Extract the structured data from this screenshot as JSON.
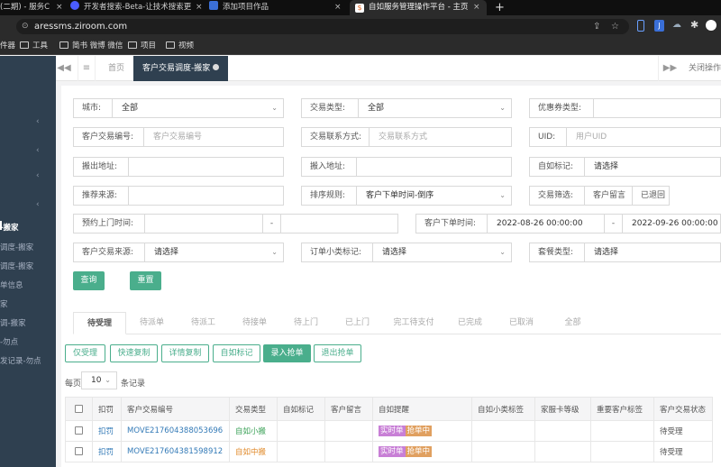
{
  "browser": {
    "tabs": [
      {
        "label": "(二期) - 服务C"
      },
      {
        "label": "开发者搜索-Beta-让技术搜索更"
      },
      {
        "label": "添加项目作品"
      },
      {
        "label": "自如服务管理操作平台 - 主页"
      }
    ],
    "new_tab": "+",
    "url": "aressms.ziroom.com",
    "bookmarks": [
      "件器",
      "工具",
      "简书 微博 微信",
      "项目",
      "视频"
    ]
  },
  "sidebar": {
    "items": [
      {
        "label": "-搬家",
        "bold": true
      },
      {
        "label": "调度-搬家"
      },
      {
        "label": "调度-搬家"
      },
      {
        "label": "单信息"
      },
      {
        "label": "家"
      },
      {
        "label": "调-搬家"
      },
      {
        "label": "-勿点"
      },
      {
        "label": "发记录-勿点"
      }
    ],
    "chevrons": [
      "‹",
      "‹",
      "‹",
      "‹"
    ]
  },
  "topnav": {
    "back_icon": "◀◀",
    "menu_icon": "≡",
    "home_tab": "首页",
    "active_tab": "客户交易调度-搬家",
    "forward_icon": "▶▶",
    "close_ops": "关闭操作"
  },
  "filters": {
    "city_label": "城市:",
    "city_value": "全部",
    "trade_type_label": "交易类型:",
    "trade_type_value": "全部",
    "coupon_label": "优惠券类型:",
    "trade_no_label": "客户交易编号:",
    "trade_no_ph": "客户交易编号",
    "contact_label": "交易联系方式:",
    "contact_ph": "交易联系方式",
    "uid_label": "UID:",
    "uid_ph": "用户UID",
    "move_out_label": "搬出地址:",
    "move_in_label": "搬入地址:",
    "ziru_mark_label": "自如标记:",
    "ziru_mark_ph": "请选择",
    "referral_label": "推荐来源:",
    "sort_label": "排序规则:",
    "sort_value": "客户下单时间-倒序",
    "trade_filter_label": "交易筛选:",
    "trade_filter_opt1": "客户留言",
    "trade_filter_opt2": "已退回",
    "appoint_label": "预约上门时间:",
    "dash1": "-",
    "order_time_label": "客户下单时间:",
    "order_time_start": "2022-08-26 00:00:00",
    "dash2": "-",
    "order_time_end": "2022-09-26 00:00:00",
    "source_label": "客户交易来源:",
    "source_ph": "请选择",
    "sub_mark_label": "订单小类标记:",
    "sub_mark_ph": "请选择",
    "package_label": "套餐类型:",
    "package_ph": "请选择",
    "query_btn": "查询",
    "reset_btn": "重置"
  },
  "status_tabs": [
    "待受理",
    "待派单",
    "待派工",
    "待接单",
    "待上门",
    "已上门",
    "完工待支付",
    "已完成",
    "已取消",
    "全部"
  ],
  "actions": [
    "仅受理",
    "快速复制",
    "详情复制",
    "自如标记",
    "录入抢单",
    "退出抢单"
  ],
  "paging": {
    "prefix": "每页",
    "size": "10",
    "suffix": "条记录"
  },
  "table": {
    "headers": [
      "扣罚",
      "客户交易编号",
      "交易类型",
      "自如标记",
      "客户留言",
      "自如提醒",
      "自如小类标签",
      "家服卡等级",
      "重要客户标签",
      "客户交易状态"
    ],
    "rows": [
      {
        "penalty": "扣罚",
        "no": "MOVE217604388053696",
        "type": "自如小搬",
        "tag1": "实时单",
        "tag2": "抢单中",
        "status": "待受理"
      },
      {
        "penalty": "扣罚",
        "no": "MOVE217604381598912",
        "type": "自如中搬",
        "tag1": "实时单",
        "tag2": "抢单中",
        "status": "待受理"
      }
    ]
  },
  "colors": {
    "sidebar": "#2f4050",
    "accent": "#4aae8c",
    "tag_realtime": "#c87fd6",
    "tag_grab": "#e0a060",
    "type_small": "#3aa157",
    "type_mid": "#e08a2a"
  }
}
